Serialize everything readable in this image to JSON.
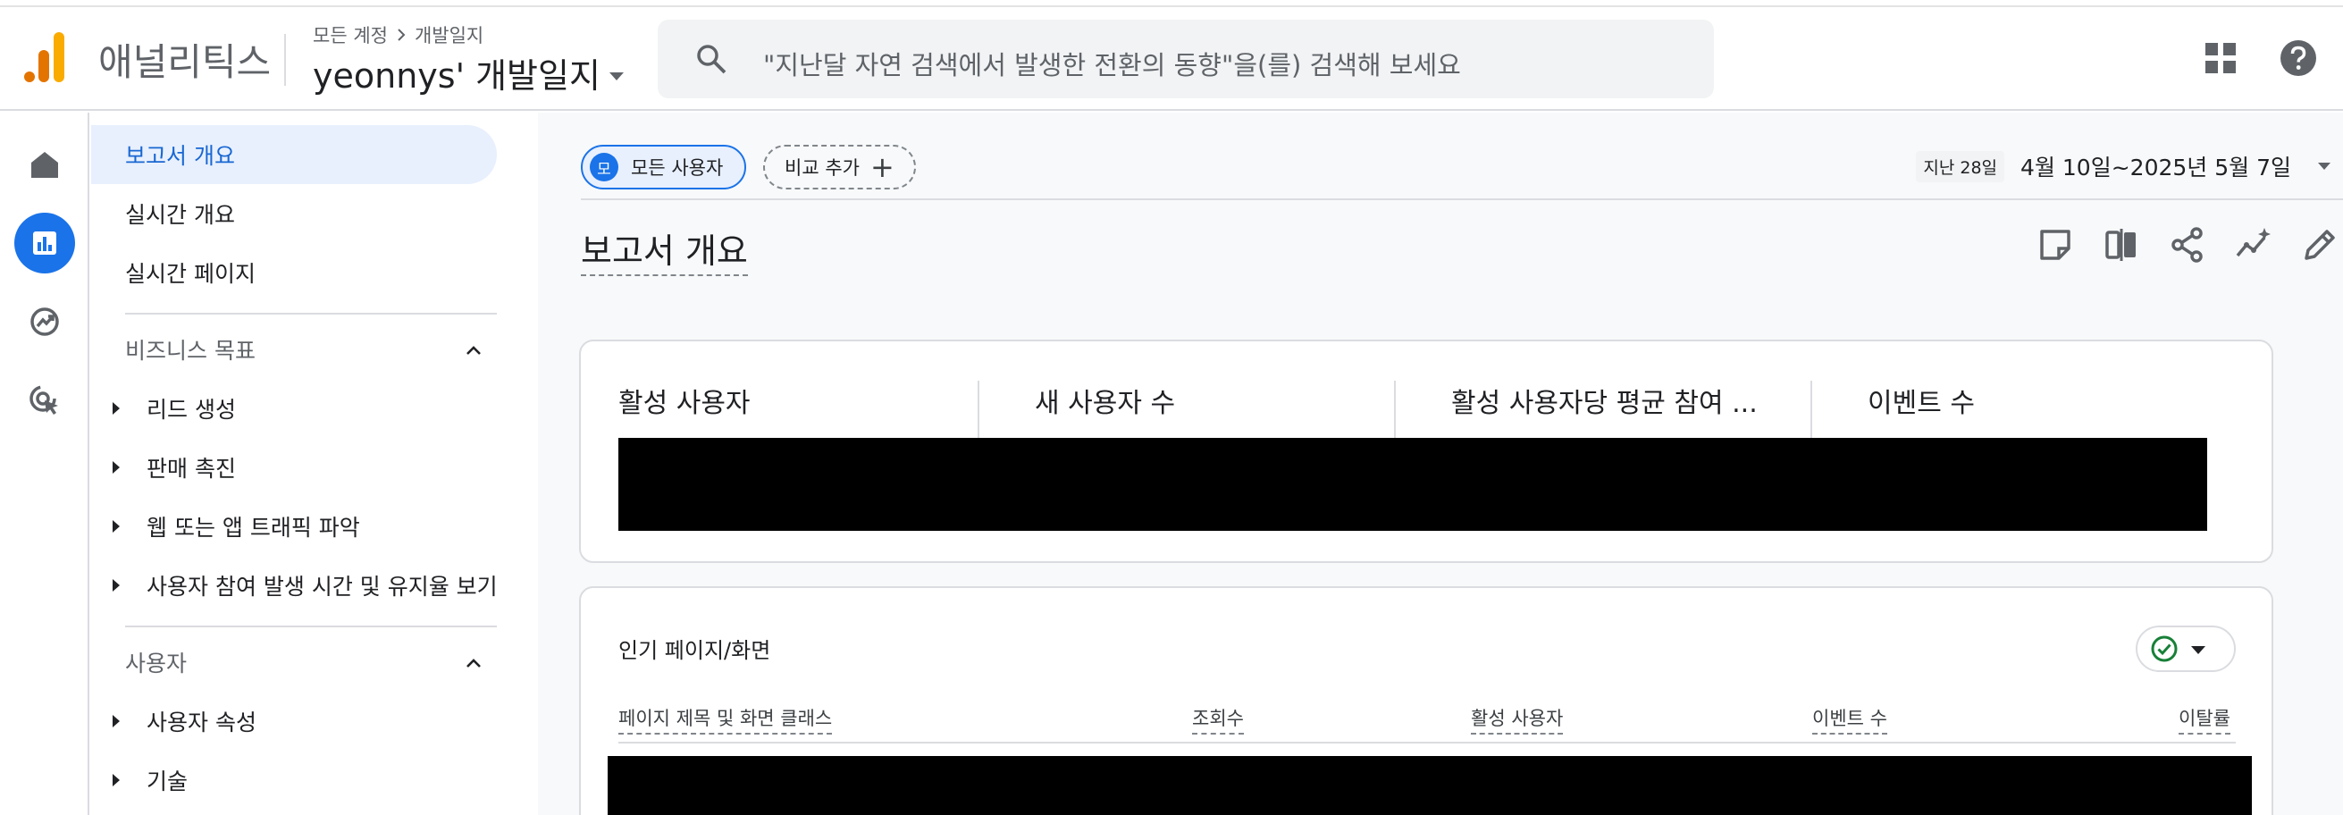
{
  "header": {
    "app_name": "애널리틱스",
    "breadcrumb": [
      "모든 계정",
      "개발일지"
    ],
    "property": "yeonnys' 개발일지",
    "search_placeholder": "\"지난달 자연 검색에서 발생한 전환의 동향\"을(를) 검색해 보세요"
  },
  "rail": [
    "home-icon",
    "reports-icon",
    "explore-icon",
    "advertising-icon"
  ],
  "sidebar": {
    "top_items": [
      {
        "label": "보고서 개요",
        "active": true
      },
      {
        "label": "실시간 개요"
      },
      {
        "label": "실시간 페이지"
      }
    ],
    "sections": [
      {
        "title": "비즈니스 목표",
        "items": [
          "리드 생성",
          "판매 촉진",
          "웹 또는 앱 트래픽 파악",
          "사용자 참여 발생 시간 및 유지율 보기"
        ]
      },
      {
        "title": "사용자",
        "items": [
          "사용자 속성",
          "기술"
        ]
      }
    ]
  },
  "main": {
    "chip_user_avatar": "모",
    "chip_user_label": "모든 사용자",
    "chip_compare_label": "비교 추가",
    "date_tag": "지난 28일",
    "date_range": "4월 10일~2025년 5월 7일",
    "page_title": "보고서 개요",
    "toolbar_icons": [
      "note-icon",
      "compare-icon",
      "share-icon",
      "insights-icon",
      "edit-icon"
    ],
    "metrics": [
      "활성 사용자",
      "새 사용자 수",
      "활성 사용자당 평균 참여 ...",
      "이벤트 수"
    ],
    "top_pages": {
      "title": "인기 페이지/화면",
      "columns": [
        "페이지 제목 및 화면 클래스",
        "조회수",
        "활성 사용자",
        "이벤트 수",
        "이탈률"
      ]
    }
  },
  "colors": {
    "accent": "#1a73e8",
    "active_bg": "#e8f0fe",
    "logo_orange": "#f9ab00",
    "logo_dark_orange": "#e37400",
    "check_green": "#188038"
  }
}
